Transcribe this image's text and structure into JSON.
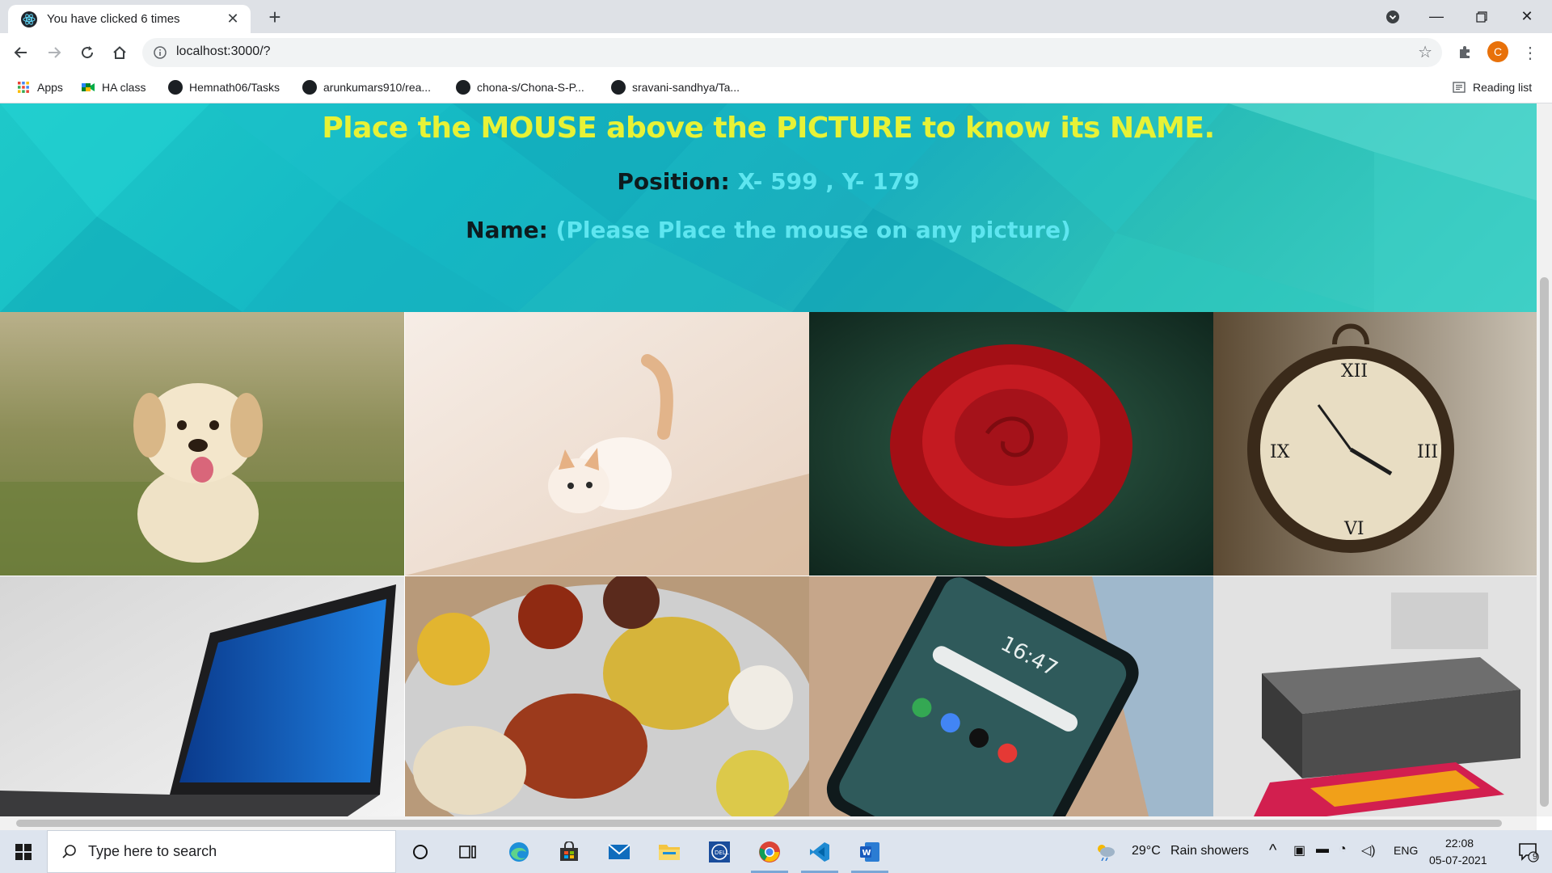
{
  "browser": {
    "tab_title": "You have clicked 6 times",
    "url": "localhost:3000/?",
    "avatar_letter": "C",
    "bookmarks": [
      {
        "label": "Apps",
        "icon": "apps-grid-icon"
      },
      {
        "label": "HA class",
        "icon": "meet-icon"
      },
      {
        "label": "Hemnath06/Tasks",
        "icon": "github-icon"
      },
      {
        "label": "arunkumars910/rea...",
        "icon": "github-icon"
      },
      {
        "label": "chona-s/Chona-S-P...",
        "icon": "github-icon"
      },
      {
        "label": "sravani-sandhya/Ta...",
        "icon": "github-icon"
      }
    ],
    "reading_list": "Reading list"
  },
  "page": {
    "heading": "Place the MOUSE above the PICTURE to know its NAME.",
    "position_label": "Position:",
    "position_value": "X- 599 , Y- 179",
    "name_label": "Name:",
    "name_value": "(Please Place the mouse on any picture)",
    "pictures": [
      {
        "subject": "puppy"
      },
      {
        "subject": "kitten"
      },
      {
        "subject": "rose"
      },
      {
        "subject": "clock"
      },
      {
        "subject": "laptop"
      },
      {
        "subject": "food"
      },
      {
        "subject": "mobile"
      },
      {
        "subject": "printer"
      }
    ]
  },
  "taskbar": {
    "search_placeholder": "Type here to search",
    "weather_temp": "29°C",
    "weather_text": "Rain showers",
    "language": "ENG",
    "time": "22:08",
    "date": "05-07-2021",
    "notification_count": "9"
  },
  "colors": {
    "heading": "#e7f236",
    "value_text": "#5ee6f0",
    "hero_teal": "#14b8c4",
    "avatar": "#e8710a"
  }
}
